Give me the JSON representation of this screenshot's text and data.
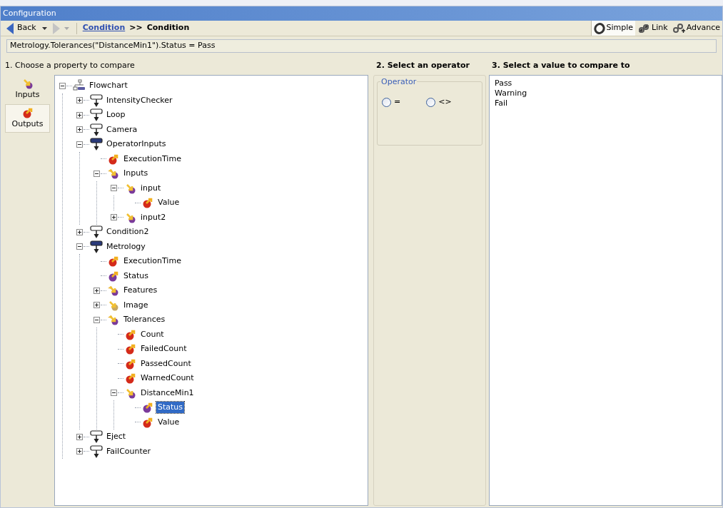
{
  "window": {
    "title": "Configuration"
  },
  "toolbar": {
    "back": "Back",
    "breadcrumb_link": "Condition",
    "breadcrumb_separator": ">>",
    "breadcrumb_current": "Condition",
    "modes": [
      {
        "label": "Simple",
        "kind": "simple",
        "selected": true
      },
      {
        "label": "Link",
        "kind": "link",
        "selected": false
      },
      {
        "label": "Advance",
        "kind": "advanced",
        "selected": false
      }
    ]
  },
  "expression": "Metrology.Tolerances(\"DistanceMin1\").Status = Pass",
  "property_section": {
    "heading": "1. Choose a property to compare",
    "side_tabs": [
      {
        "label": "Inputs",
        "kind": "inputs",
        "selected": false
      },
      {
        "label": "Outputs",
        "kind": "outputs",
        "selected": true
      }
    ],
    "tree": [
      {
        "label": "Flowchart",
        "kind": "flow",
        "expanded": true,
        "selected": false,
        "children": [
          {
            "label": "IntensityChecker",
            "kind": "block",
            "expanded": false,
            "selected": false
          },
          {
            "label": "Loop",
            "kind": "block",
            "expanded": false,
            "selected": false
          },
          {
            "label": "Camera",
            "kind": "block",
            "expanded": false,
            "selected": false
          },
          {
            "label": "OperatorInputs",
            "kind": "block_dark",
            "expanded": true,
            "selected": false,
            "children": [
              {
                "label": "ExecutionTime",
                "kind": "output",
                "selected": false
              },
              {
                "label": "Inputs",
                "kind": "group",
                "expanded": true,
                "selected": false,
                "children": [
                  {
                    "label": "input",
                    "kind": "input",
                    "expanded": true,
                    "selected": false,
                    "children": [
                      {
                        "label": "Value",
                        "kind": "output",
                        "selected": false
                      }
                    ]
                  },
                  {
                    "label": "input2",
                    "kind": "input",
                    "expanded": false,
                    "selected": false
                  }
                ]
              }
            ]
          },
          {
            "label": "Condition2",
            "kind": "block",
            "expanded": false,
            "selected": false
          },
          {
            "label": "Metrology",
            "kind": "block_dark",
            "expanded": true,
            "selected": false,
            "children": [
              {
                "label": "ExecutionTime",
                "kind": "output",
                "selected": false
              },
              {
                "label": "Status",
                "kind": "status",
                "selected": false
              },
              {
                "label": "Features",
                "kind": "group",
                "expanded": false,
                "selected": false
              },
              {
                "label": "Image",
                "kind": "image",
                "expanded": false,
                "selected": false
              },
              {
                "label": "Tolerances",
                "kind": "group",
                "expanded": true,
                "selected": false,
                "children": [
                  {
                    "label": "Count",
                    "kind": "output",
                    "selected": false
                  },
                  {
                    "label": "FailedCount",
                    "kind": "output",
                    "selected": false
                  },
                  {
                    "label": "PassedCount",
                    "kind": "output",
                    "selected": false
                  },
                  {
                    "label": "WarnedCount",
                    "kind": "output",
                    "selected": false
                  },
                  {
                    "label": "DistanceMin1",
                    "kind": "input",
                    "expanded": true,
                    "selected": false,
                    "children": [
                      {
                        "label": "Status",
                        "kind": "status",
                        "selected": true
                      },
                      {
                        "label": "Value",
                        "kind": "output",
                        "selected": false
                      }
                    ]
                  }
                ]
              }
            ]
          },
          {
            "label": "Eject",
            "kind": "block",
            "expanded": false,
            "selected": false
          },
          {
            "label": "FailCounter",
            "kind": "block",
            "expanded": false,
            "selected": false
          }
        ]
      }
    ]
  },
  "operator_section": {
    "heading": "2. Select an operator",
    "group_label": "Operator",
    "options": [
      {
        "label": "=",
        "selected": false
      },
      {
        "label": "<>",
        "selected": false
      }
    ]
  },
  "value_section": {
    "heading": "3. Select a value to compare to",
    "values": [
      {
        "label": "Pass",
        "selected": false
      },
      {
        "label": "Warning",
        "selected": false
      },
      {
        "label": "Fail",
        "selected": false
      }
    ]
  }
}
